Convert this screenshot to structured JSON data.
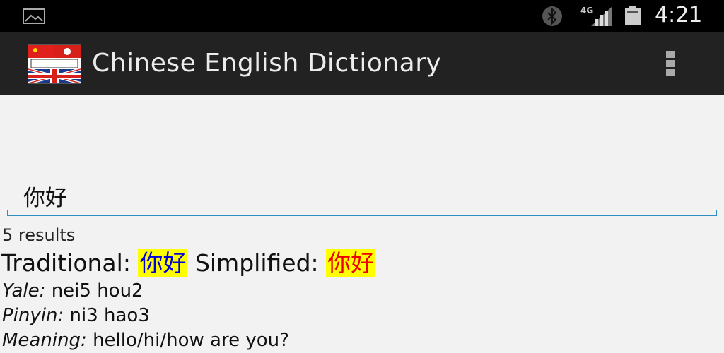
{
  "status_bar": {
    "network_type": "4G",
    "clock": "4:21"
  },
  "action_bar": {
    "title": "Chinese English Dictionary"
  },
  "search": {
    "value": "你好"
  },
  "results": {
    "count_text": "5 results",
    "entries": [
      {
        "traditional_label": "Traditional:",
        "traditional": "你好",
        "simplified_label": "Simplified:",
        "simplified": "你好",
        "yale_label": "Yale:",
        "yale": "nei5 hou2",
        "pinyin_label": "Pinyin:",
        "pinyin": "ni3 hao3",
        "meaning_label": "Meaning:",
        "meaning": "hello/hi/how are you?"
      }
    ]
  },
  "colors": {
    "accent": "#2f8fc4",
    "highlight": "#ffff00",
    "traditional": "#0000dd",
    "simplified": "#ee0000"
  },
  "icons": [
    "image-notification-icon",
    "bluetooth-icon",
    "signal-icon",
    "battery-icon",
    "app-logo-icon",
    "overflow-menu-icon"
  ]
}
